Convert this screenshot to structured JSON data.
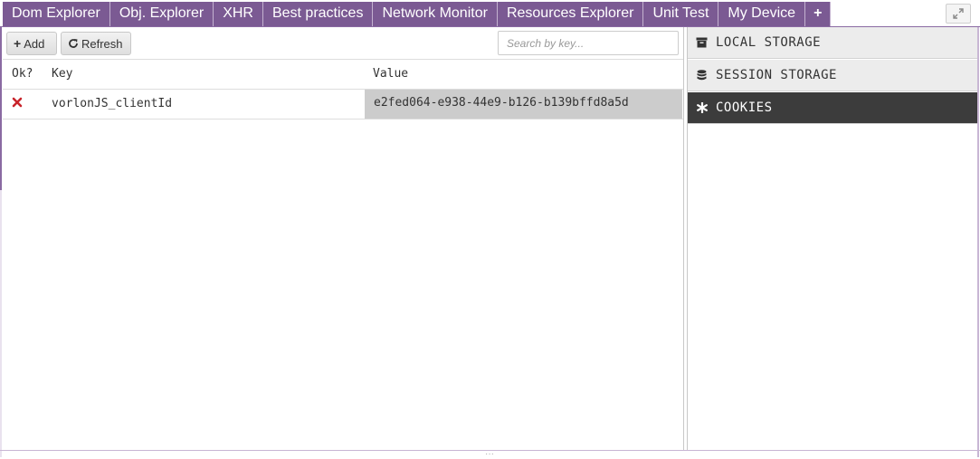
{
  "tabs": [
    {
      "label": "Dom Explorer"
    },
    {
      "label": "Obj. Explorer"
    },
    {
      "label": "XHR"
    },
    {
      "label": "Best practices"
    },
    {
      "label": "Network Monitor"
    },
    {
      "label": "Resources Explorer"
    },
    {
      "label": "Unit Test"
    },
    {
      "label": "My Device"
    },
    {
      "label": "+"
    }
  ],
  "toolbar": {
    "add_label": "Add",
    "refresh_label": "Refresh",
    "search_placeholder": "Search by key..."
  },
  "table": {
    "columns": [
      "Ok?",
      "Key",
      "Value"
    ],
    "rows": [
      {
        "ok": false,
        "key": "vorlonJS_clientId",
        "value": "e2fed064-e938-44e9-b126-b139bffd8a5d"
      }
    ]
  },
  "storage_panel": {
    "items": [
      {
        "label": "LOCAL STORAGE",
        "icon": "archive-icon",
        "active": false
      },
      {
        "label": "SESSION STORAGE",
        "icon": "database-icon",
        "active": false
      },
      {
        "label": "COOKIES",
        "icon": "asterisk-icon",
        "active": true
      }
    ]
  },
  "colors": {
    "tab_bg": "#7b5a93",
    "active_panel_bg": "#3c3c3c",
    "error_red": "#c8242b",
    "selected_cell_bg": "#cccccc"
  }
}
